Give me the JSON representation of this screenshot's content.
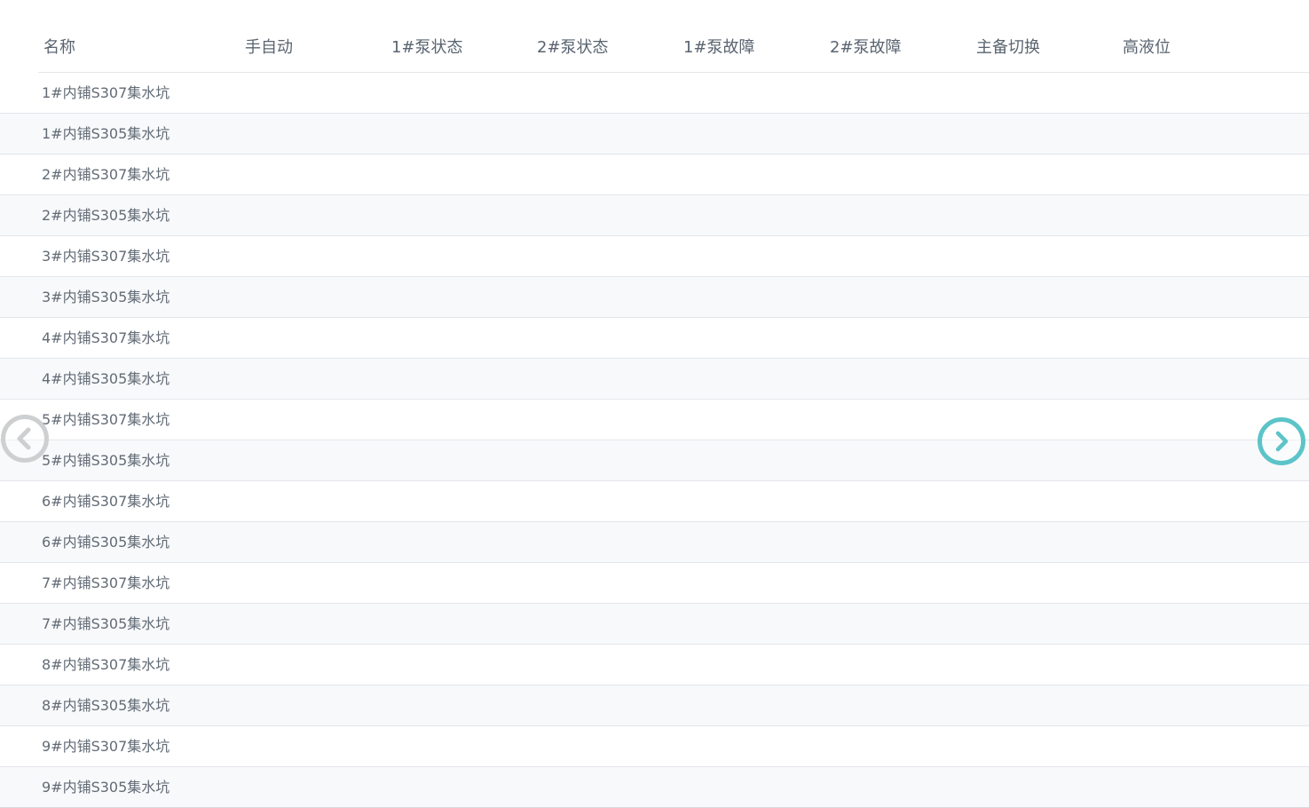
{
  "table": {
    "headers": [
      {
        "id": "name",
        "label": "名称"
      },
      {
        "id": "mode",
        "label": "手自动"
      },
      {
        "id": "pump1-status",
        "label": "1#泵状态"
      },
      {
        "id": "pump2-status",
        "label": "2#泵状态"
      },
      {
        "id": "pump1-fault",
        "label": "1#泵故障"
      },
      {
        "id": "pump2-fault",
        "label": "2#泵故障"
      },
      {
        "id": "switchover",
        "label": "主备切换"
      },
      {
        "id": "high-level",
        "label": "高液位"
      }
    ],
    "rows": [
      {
        "name": "1#内铺S307集水坑"
      },
      {
        "name": "1#内铺S305集水坑"
      },
      {
        "name": "2#内铺S307集水坑"
      },
      {
        "name": "2#内铺S305集水坑"
      },
      {
        "name": "3#内铺S307集水坑"
      },
      {
        "name": "3#内铺S305集水坑"
      },
      {
        "name": "4#内铺S307集水坑"
      },
      {
        "name": "4#内铺S305集水坑"
      },
      {
        "name": "5#内铺S307集水坑"
      },
      {
        "name": "5#内铺S305集水坑"
      },
      {
        "name": "6#内铺S307集水坑"
      },
      {
        "name": "6#内铺S305集水坑"
      },
      {
        "name": "7#内铺S307集水坑"
      },
      {
        "name": "7#内铺S305集水坑"
      },
      {
        "name": "8#内铺S307集水坑"
      },
      {
        "name": "8#内铺S305集水坑"
      },
      {
        "name": "9#内铺S307集水坑"
      },
      {
        "name": "9#内铺S305集水坑"
      }
    ]
  },
  "navigation": {
    "prev_icon": "chevron-left-icon",
    "next_icon": "chevron-right-icon",
    "prev_color": "#cdcfd1",
    "next_color": "#5cc4c8"
  },
  "colors": {
    "header_text": "#5a6470",
    "row_text": "#626b75",
    "row_alt_bg": "#f8f9fb",
    "border": "#e3e6ea"
  }
}
